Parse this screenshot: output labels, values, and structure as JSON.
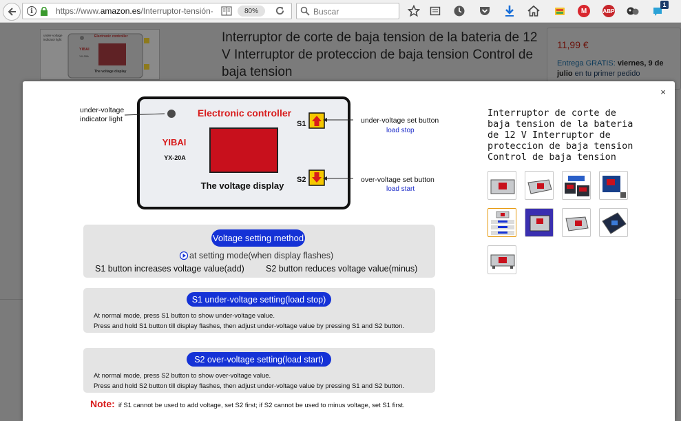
{
  "browser": {
    "url_prefix": "https://www.",
    "url_domain": "amazon.es",
    "url_path": "/Interruptor-tensión-",
    "zoom": "80%",
    "search_placeholder": "Buscar",
    "notification_count": "1",
    "badge_mega": "M",
    "badge_abp": "ABP"
  },
  "product": {
    "title": "Interruptor de corte de baja tension de la bateria de 12 V Interruptor de proteccion de baja tension Control de baja tension",
    "price": "11,99 €",
    "delivery_prefix": "Entrega GRATIS:",
    "delivery_date": "viernes, 9 de julio",
    "delivery_suffix": "en tu primer pedido"
  },
  "modal": {
    "close_label": "×",
    "image": {
      "brand": "YIBAI",
      "model": "YX-20A",
      "controller_title": "Electronic controller",
      "display_label": "The voltage display",
      "s1": "S1",
      "s2": "S2",
      "uv_indicator_label_1": "under-voltage",
      "uv_indicator_label_2": "indicator light",
      "uv_set_button": "under-voltage set button",
      "load_stop": "load stop",
      "ov_set_button": "over-voltage set button",
      "load_start": "load start",
      "panel1_title": "Voltage setting method",
      "panel1_line1": "at setting mode(when display flashes)",
      "panel1_line2a": "S1 button increases voltage value(add)",
      "panel1_line2b": "S2 button reduces voltage value(minus)",
      "panel2_title": "S1 under-voltage setting(load stop)",
      "panel2_line1": "At normal mode, press S1 button to show under-voltage value.",
      "panel2_line2": "Press and hold S1 button till display flashes, then adjust under-voltage value by pressing S1 and S2 button.",
      "panel3_title": "S2 over-voltage setting(load start)",
      "panel3_line1": "At normal mode, press S2 button to show over-voltage value.",
      "panel3_line2": "Press and hold S2 button till display flashes, then adjust under-voltage value by pressing S1 and S2 button.",
      "note_label": "Note:",
      "note_text": "if S1 cannot be used to add voltage, set S2 first;  if S2 cannot be used to minus voltage, set S1 first."
    },
    "side_title": "Interruptor de corte de baja tension de la bateria de 12 V Interruptor de proteccion de baja tension Control de baja tension"
  },
  "thumbnails_small": {
    "brand": "YIBAI",
    "model": "YX-20A",
    "controller": "Electronic controller",
    "display": "The voltage display",
    "uv": "under-voltage",
    "light": "indicator light",
    "uvset": "under-voltage set button",
    "ovset": "over-voltage set button",
    "stop": "load stop",
    "start": "load start"
  },
  "colors": {
    "panel_red": "#d81c1c",
    "display_red": "#c8101c",
    "pill_blue": "#1532d6",
    "button_yellow": "#f5c800",
    "selected_thumb": "#e69a0f"
  }
}
